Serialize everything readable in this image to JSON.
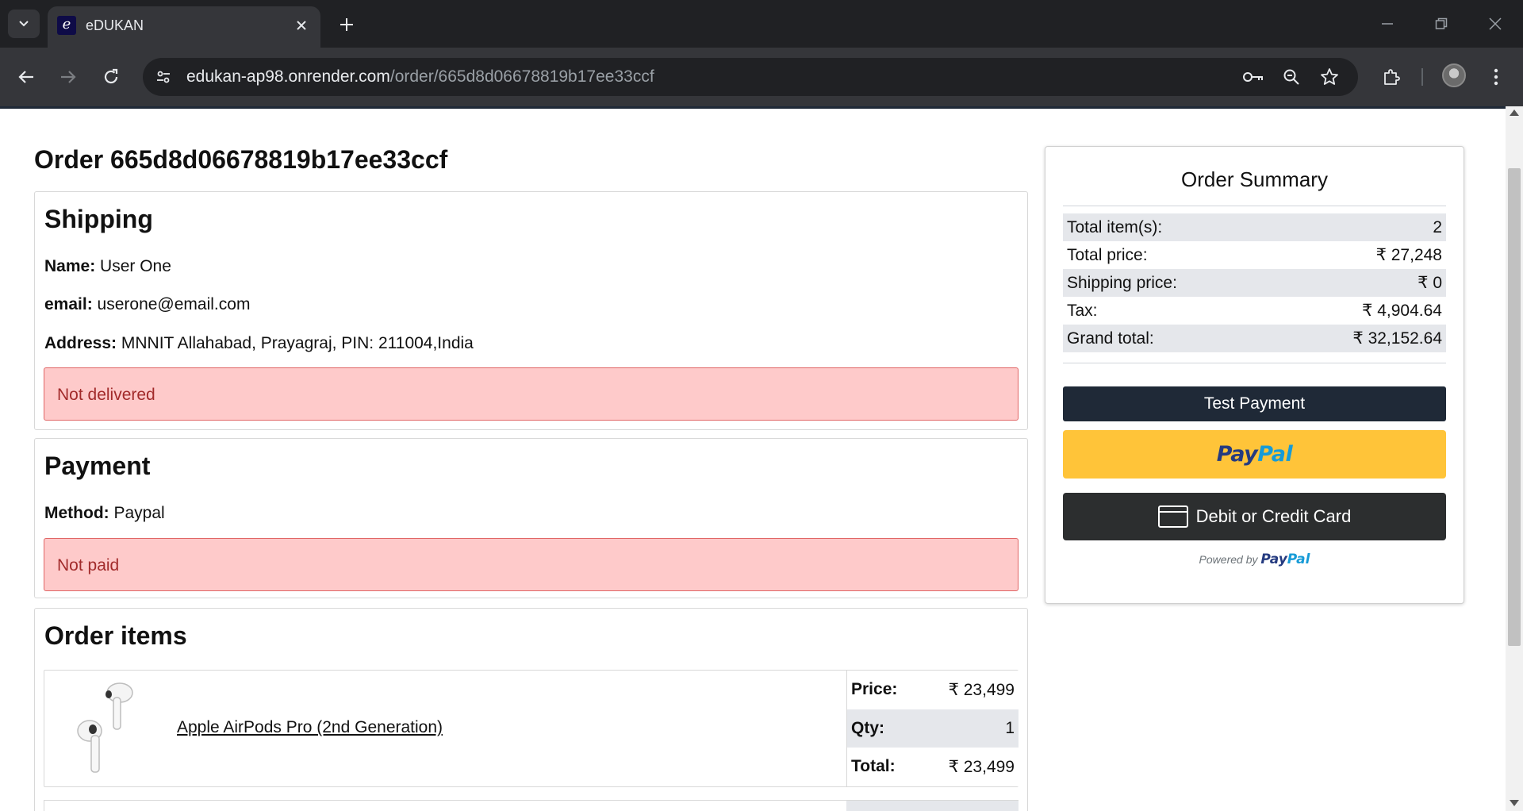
{
  "browser": {
    "tab_title": "eDUKAN",
    "favicon_letter": "e",
    "url_domain": "edukan-ap98.onrender.com",
    "url_path": "/order/665d8d06678819b17ee33ccf",
    "icons": [
      "tab-search-icon",
      "close-icon",
      "plus-icon",
      "minimize-icon",
      "restore-icon",
      "close-window-icon",
      "back-arrow-icon",
      "forward-arrow-icon",
      "reload-icon",
      "site-info-icon",
      "key-icon",
      "zoom-icon",
      "star-icon",
      "extensions-icon",
      "avatar",
      "kebab-menu-icon"
    ]
  },
  "order": {
    "title": "Order 665d8d06678819b17ee33ccf"
  },
  "shipping": {
    "heading": "Shipping",
    "name_label": "Name:",
    "name_value": "User One",
    "email_label": "email:",
    "email_value": "userone@email.com",
    "address_label": "Address:",
    "address_value": "MNNIT Allahabad, Prayagraj, PIN: 211004,India",
    "status": "Not delivered"
  },
  "payment": {
    "heading": "Payment",
    "method_label": "Method:",
    "method_value": "Paypal",
    "status": "Not paid"
  },
  "items": {
    "heading": "Order items",
    "list": [
      {
        "name": "Apple AirPods Pro (2nd Generation)",
        "price_label": "Price:",
        "price": "₹ 23,499",
        "qty_label": "Qty:",
        "qty": "1",
        "total_label": "Total:",
        "total": "₹ 23,499"
      }
    ]
  },
  "summary": {
    "heading": "Order Summary",
    "rows": [
      {
        "label": "Total item(s):",
        "value": "2"
      },
      {
        "label": "Total price:",
        "value": "₹ 27,248"
      },
      {
        "label": "Shipping price:",
        "value": "₹ 0"
      },
      {
        "label": "Tax:",
        "value": "₹ 4,904.64"
      },
      {
        "label": "Grand total:",
        "value": "₹ 32,152.64"
      }
    ],
    "test_payment_label": "Test Payment",
    "paypal_label_a": "Pay",
    "paypal_label_b": "Pal",
    "card_label": "Debit or Credit Card",
    "powered_by": "Powered by",
    "powered_brand_a": "Pay",
    "powered_brand_b": "Pal"
  },
  "colors": {
    "chrome_dark": "#202124",
    "chrome_toolbar": "#35363a",
    "alert_bg": "#fecaca",
    "alert_text": "#a22b2b",
    "paypal_yellow": "#ffc439",
    "button_dark": "#1f2937"
  }
}
